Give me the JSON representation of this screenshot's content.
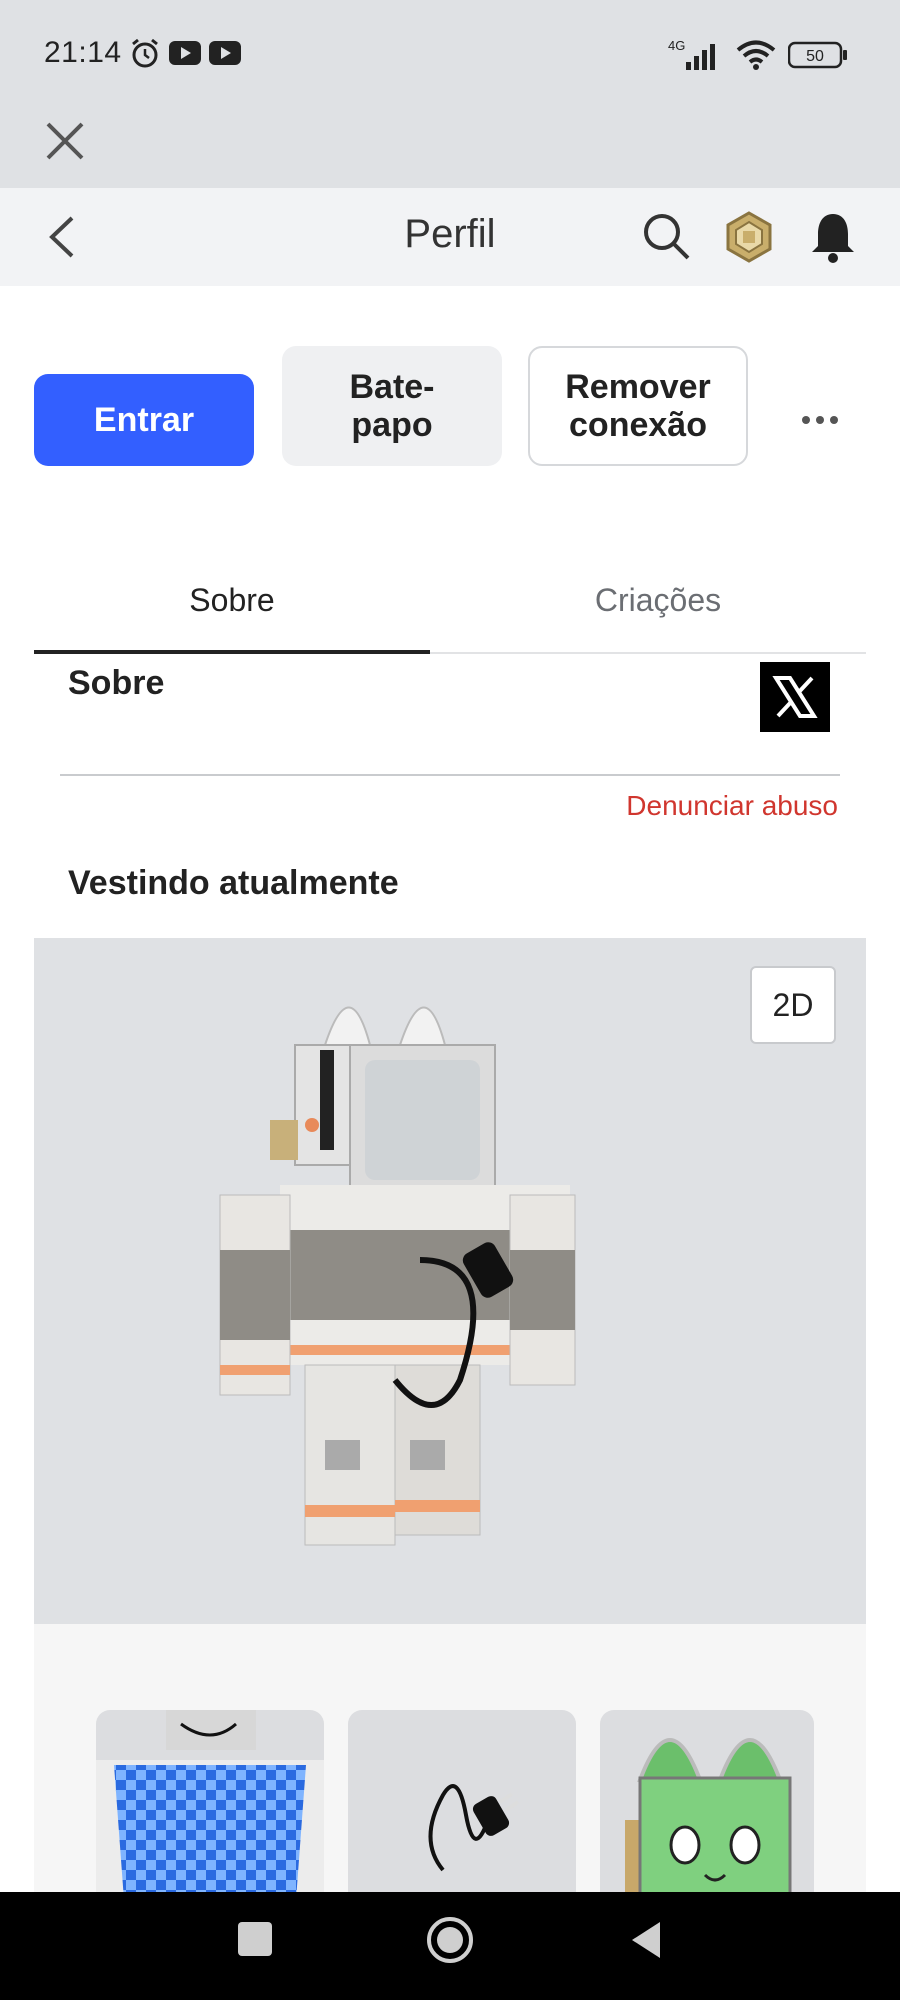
{
  "status_bar": {
    "time": "21:14",
    "network": "4G",
    "battery": "50",
    "icons_left": [
      "alarm-icon",
      "youtube-icon",
      "youtube-icon"
    ],
    "icons_right": [
      "signal-icon",
      "wifi-icon",
      "battery-icon"
    ]
  },
  "header": {
    "title": "Perfil",
    "icons": [
      "back-icon",
      "search-icon",
      "robux-icon",
      "bell-icon"
    ]
  },
  "actions": {
    "join_label": "Entrar",
    "chat_label": "Bate-papo",
    "chat_line1": "Bate-",
    "chat_line2": "papo",
    "remove_line1": "Remover",
    "remove_line2": "conexão"
  },
  "tabs": [
    {
      "label": "Sobre",
      "active": true
    },
    {
      "label": "Criações",
      "active": false
    }
  ],
  "about": {
    "title": "Sobre",
    "social": "x-logo-icon",
    "report_label": "Denunciar abuso"
  },
  "wearing": {
    "title": "Vestindo atualmente",
    "toggle_label": "2D",
    "items": [
      {
        "icon": "checkered-shirt-icon"
      },
      {
        "icon": "plug-cable-icon"
      },
      {
        "icon": "green-cat-head-icon"
      }
    ]
  },
  "colors": {
    "accent": "#335fff",
    "report": "#d0362e",
    "panel": "#dfe1e4"
  }
}
